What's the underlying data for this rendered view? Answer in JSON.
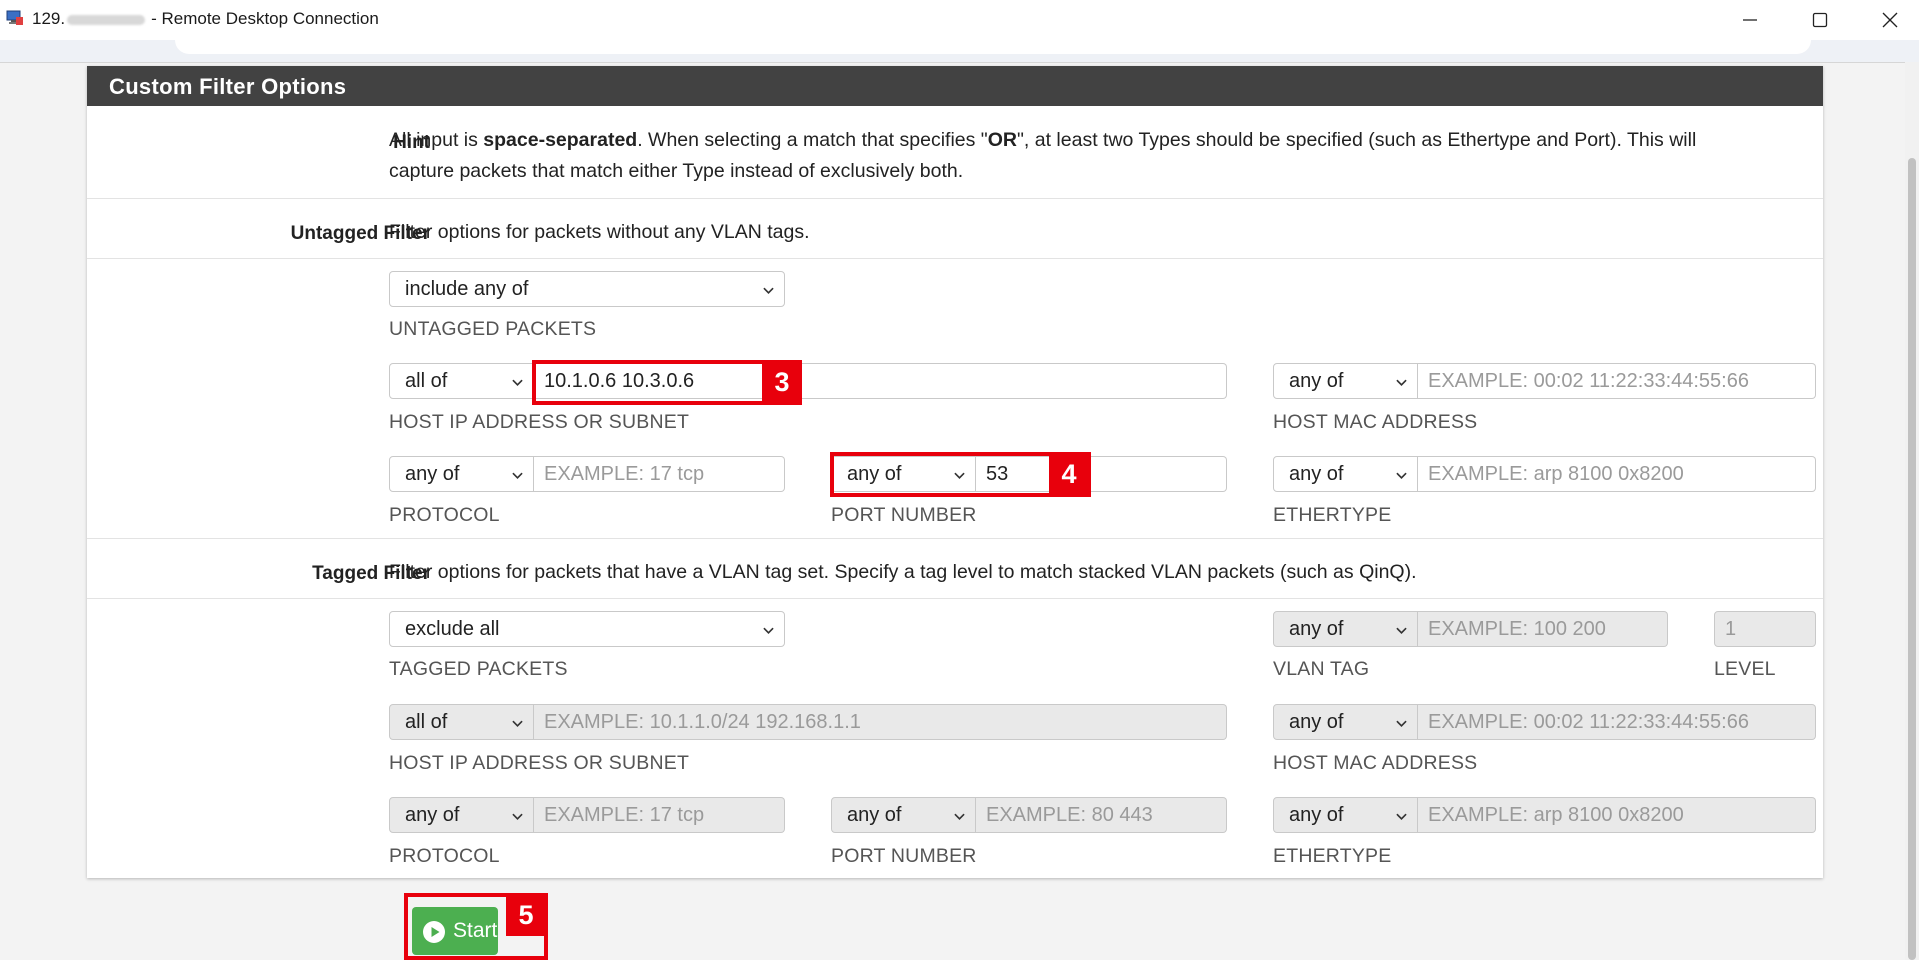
{
  "window": {
    "title_prefix": "129.",
    "title_suffix": "- Remote Desktop Connection"
  },
  "panel": {
    "title": "Custom Filter Options"
  },
  "hint": {
    "label": "Hint",
    "text_a": "All input is ",
    "text_bold1": "space-separated",
    "text_b": ". When selecting a match that specifies \"",
    "text_bold2": "OR",
    "text_c": "\", at least two Types should be specified (such as Ethertype and Port). This will",
    "text_d": "capture packets that match either Type instead of exclusively both."
  },
  "untagged": {
    "label": "Untagged Filter",
    "description": "Filter options for packets without any VLAN tags.",
    "packets_select": "include any of",
    "packets_caption": "UNTAGGED PACKETS",
    "host_ip": {
      "match": "all of",
      "value": "10.1.0.6 10.3.0.6",
      "caption": "HOST IP ADDRESS OR SUBNET"
    },
    "host_mac": {
      "match": "any of",
      "placeholder": "EXAMPLE: 00:02 11:22:33:44:55:66",
      "caption": "HOST MAC ADDRESS"
    },
    "protocol": {
      "match": "any of",
      "placeholder": "EXAMPLE: 17 tcp",
      "caption": "PROTOCOL"
    },
    "port": {
      "match": "any of",
      "value": "53",
      "caption": "PORT NUMBER"
    },
    "ethertype": {
      "match": "any of",
      "placeholder": "EXAMPLE: arp 8100 0x8200",
      "caption": "ETHERTYPE"
    }
  },
  "tagged": {
    "label": "Tagged Filter",
    "description": "Filter options for packets that have a VLAN tag set. Specify a tag level to match stacked VLAN packets (such as QinQ).",
    "packets_select": "exclude all",
    "packets_caption": "TAGGED PACKETS",
    "vlan_tag": {
      "match": "any of",
      "placeholder": "EXAMPLE: 100 200",
      "caption": "VLAN TAG"
    },
    "level": {
      "placeholder": "1",
      "caption": "LEVEL"
    },
    "host_ip": {
      "match": "all of",
      "placeholder": "EXAMPLE: 10.1.1.0/24 192.168.1.1",
      "caption": "HOST IP ADDRESS OR SUBNET"
    },
    "host_mac": {
      "match": "any of",
      "placeholder": "EXAMPLE: 00:02 11:22:33:44:55:66",
      "caption": "HOST MAC ADDRESS"
    },
    "protocol": {
      "match": "any of",
      "placeholder": "EXAMPLE: 17 tcp",
      "caption": "PROTOCOL"
    },
    "port": {
      "match": "any of",
      "placeholder": "EXAMPLE: 80 443",
      "caption": "PORT NUMBER"
    },
    "ethertype": {
      "match": "any of",
      "placeholder": "EXAMPLE: arp 8100 0x8200",
      "caption": "ETHERTYPE"
    }
  },
  "actions": {
    "start_label": "Start"
  },
  "annotations": {
    "step3": "3",
    "step4": "4",
    "step5": "5",
    "color": "#e8000c"
  },
  "colors": {
    "header_bg": "#424242",
    "start_button": "#4caf50"
  },
  "icons": [
    "rdp-app-icon",
    "minimize-icon",
    "maximize-icon",
    "close-icon",
    "chevron-down-icon",
    "play-circle-icon"
  ]
}
